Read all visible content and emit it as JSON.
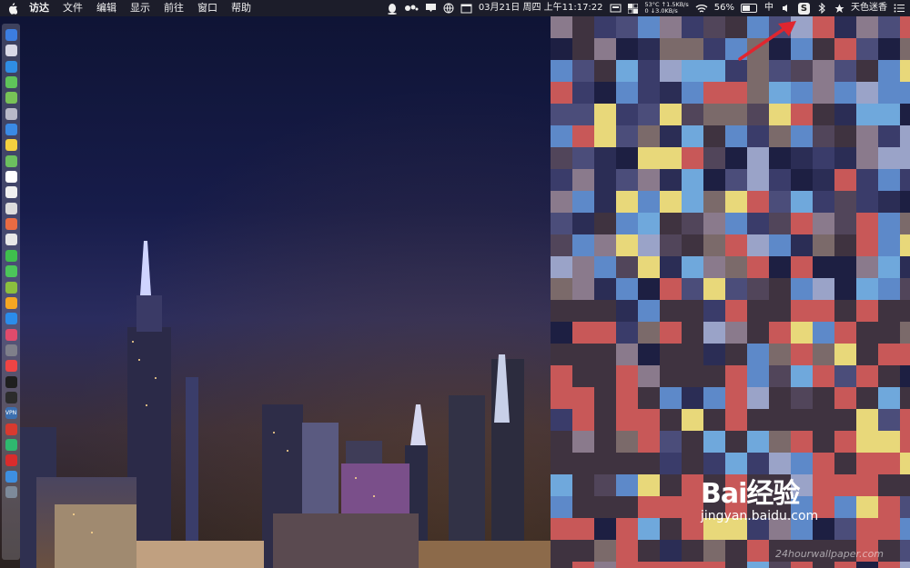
{
  "menubar": {
    "app_name": "访达",
    "menus": [
      "文件",
      "编辑",
      "显示",
      "前往",
      "窗口",
      "帮助"
    ],
    "clock": "03月21日 周四 上午11:17:22",
    "temperature": "53°C",
    "net_up": "↑1.5KB/s",
    "net_down": "0 ↓3.0KB/s",
    "battery_percent": "56%",
    "input_method": "中",
    "user_name": "天色迷香",
    "icons": [
      "apple-icon",
      "qq-icon",
      "cloud-dots-icon",
      "inbox-icon",
      "globe-icon",
      "calendar-icon",
      "display-icon",
      "grid-icon",
      "wifi-icon",
      "battery-icon",
      "input-method-icon",
      "volume-icon",
      "scribble-s-icon",
      "bluetooth-icon",
      "star-icon",
      "list-icon"
    ]
  },
  "dock": {
    "icons": [
      "finder-icon",
      "launchpad-icon",
      "safari-icon",
      "wechat-icon",
      "android-icon",
      "disk-icon",
      "app-store-icon",
      "notes-icon",
      "maps-icon",
      "calendar-icon",
      "file-icon",
      "document-icon",
      "photos-icon",
      "chrome-icon",
      "messages-icon",
      "wechat-green-icon",
      "stocks-icon",
      "sketch-icon",
      "app-store-blue-icon",
      "itunes-icon",
      "settings-icon",
      "vivaldi-icon",
      "terminal-icon",
      "terminal2-icon",
      "vpn-icon",
      "yandex-icon",
      "wechat-work-icon",
      "netease-music-icon",
      "preview-icon",
      "trash-icon"
    ],
    "colors": [
      "#3c7de0",
      "#d9d9e6",
      "#2f8de4",
      "#5fc35a",
      "#78c257",
      "#b9b9c8",
      "#3a8ae5",
      "#f4d03f",
      "#6cbf5f",
      "#ffffff",
      "#f0f0f0",
      "#dcdcdc",
      "#e96b43",
      "#e8e8e8",
      "#3fbf4d",
      "#4cc55a",
      "#8bbf3e",
      "#f5a623",
      "#2b8ceb",
      "#e04b6c",
      "#7f7f8a",
      "#ef4444",
      "#1f1f1f",
      "#2c2c2c",
      "#3b6fb0",
      "#d83a2f",
      "#2fb86f",
      "#d92c2c",
      "#3e8fe0",
      "#7d8a9a"
    ],
    "vpn_label": "VPN"
  },
  "watermark": {
    "brand": "Bai经验",
    "site": "jingyan.baidu.com",
    "wallpaper_site": "24hourwallpaper.com"
  },
  "colors": {
    "arrow": "#e0262f",
    "menubar_bg": "#1e1e28"
  }
}
